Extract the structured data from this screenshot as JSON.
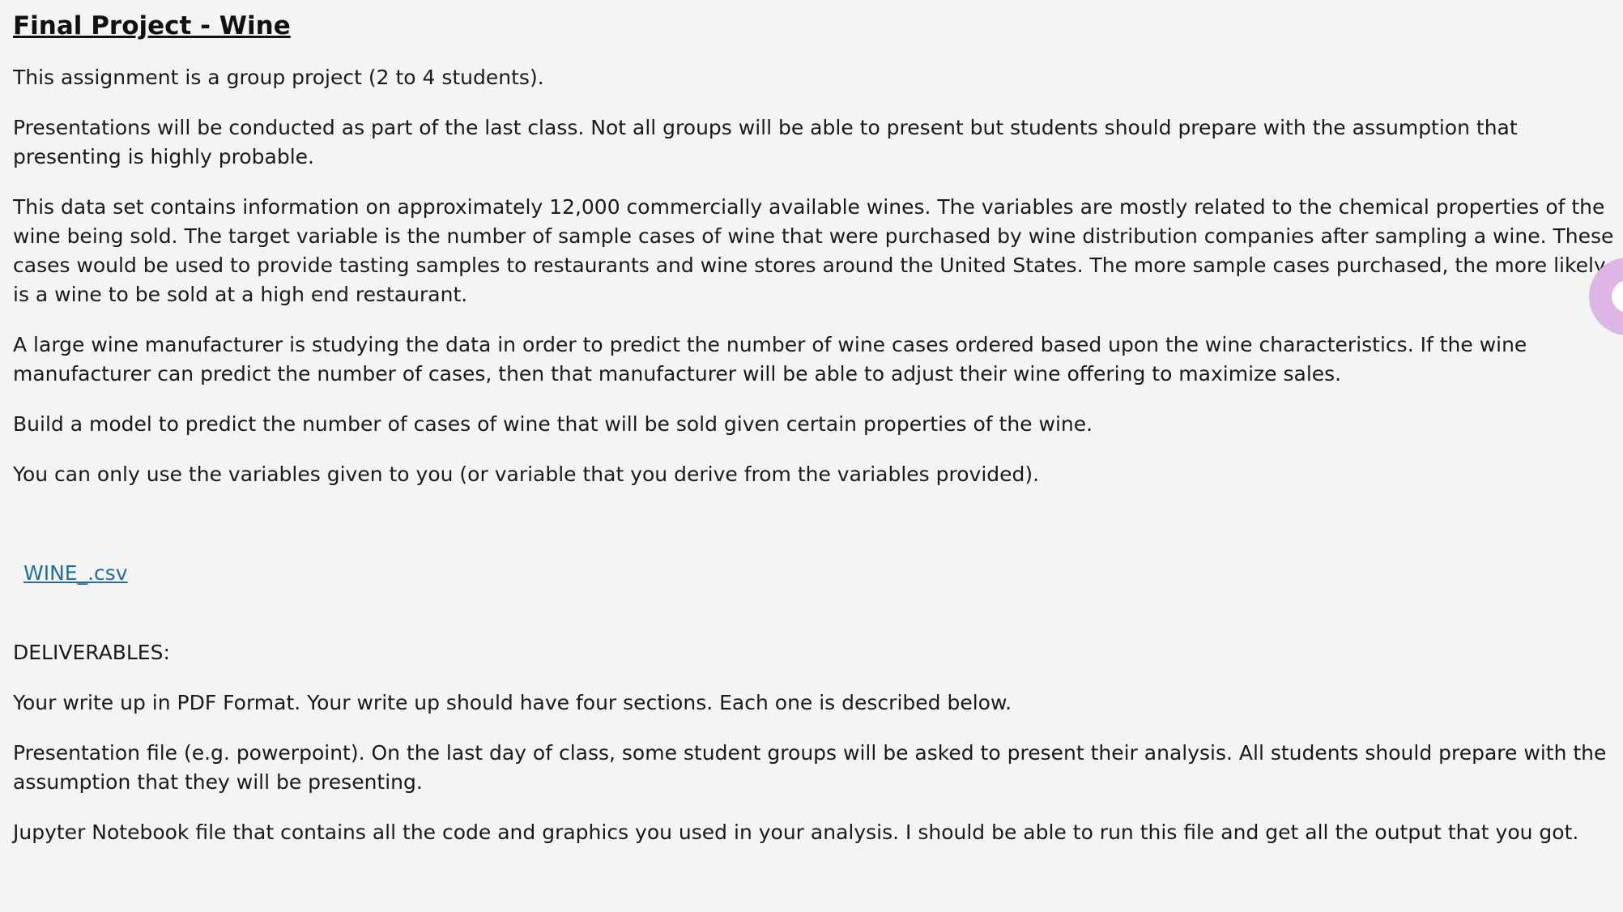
{
  "document": {
    "title": "Final Project - Wine",
    "paragraphs": [
      "This assignment is a group project (2 to 4 students).",
      "Presentations will be conducted as part of the last class. Not all groups will be able to present but students should prepare with the assumption that presenting is highly probable.",
      "This data set contains information on approximately 12,000 commercially available wines. The variables are mostly related to the chemical properties of the wine being sold. The target variable is the number of sample cases of wine that were purchased by wine distribution companies after sampling a wine. These cases would be used to provide tasting samples to restaurants and wine stores around the United States. The more sample cases purchased, the more likely is a wine to be sold at a high end restaurant.",
      "A large wine manufacturer is studying the data in order to predict the number of wine cases ordered based upon the wine characteristics. If the wine manufacturer can predict the number of cases, then that manufacturer will be able to adjust their wine offering to maximize sales.",
      "Build a model to predict the number of cases of wine that will be sold given certain properties of the wine.",
      "You can only use the variables given to you (or variable that you derive from the variables provided)."
    ],
    "file_link": "WINE_.csv",
    "deliverables_heading": "DELIVERABLES:",
    "deliverables": [
      "Your write up in PDF Format. Your write up should have four sections. Each one is described below.",
      "Presentation file (e.g. powerpoint). On the last day of class, some student groups will be asked to present their analysis. All students should prepare with the assumption that they will be presenting.",
      "Jupyter Notebook file that contains all the code and graphics you used in your analysis. I should be able to run this file and get all the output that you got."
    ]
  },
  "floating_button": {
    "icon": "accessibility-launcher-icon",
    "color": "#ddb6e6"
  }
}
